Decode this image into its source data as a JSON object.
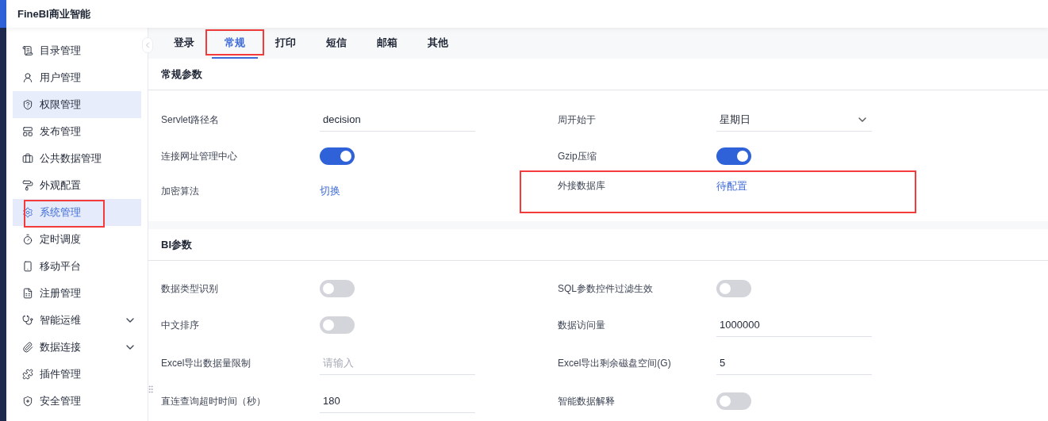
{
  "app": {
    "title": "FineBI商业智能"
  },
  "sidebar": {
    "items": [
      {
        "label": "目录管理",
        "selected": false,
        "hovered": false,
        "annotated": false
      },
      {
        "label": "用户管理",
        "selected": false,
        "hovered": false,
        "annotated": false
      },
      {
        "label": "权限管理",
        "selected": false,
        "hovered": true,
        "annotated": false
      },
      {
        "label": "发布管理",
        "selected": false,
        "hovered": false,
        "annotated": false
      },
      {
        "label": "公共数据管理",
        "selected": false,
        "hovered": false,
        "annotated": false
      },
      {
        "label": "外观配置",
        "selected": false,
        "hovered": false,
        "annotated": false
      },
      {
        "label": "系统管理",
        "selected": true,
        "hovered": false,
        "annotated": true
      },
      {
        "label": "定时调度",
        "selected": false,
        "hovered": false,
        "annotated": false
      },
      {
        "label": "移动平台",
        "selected": false,
        "hovered": false,
        "annotated": false
      },
      {
        "label": "注册管理",
        "selected": false,
        "hovered": false,
        "annotated": false
      },
      {
        "label": "智能运维",
        "selected": false,
        "hovered": false,
        "annotated": false,
        "expanded": false
      },
      {
        "label": "数据连接",
        "selected": false,
        "hovered": false,
        "annotated": false,
        "expanded": false
      },
      {
        "label": "插件管理",
        "selected": false,
        "hovered": false,
        "annotated": false
      },
      {
        "label": "安全管理",
        "selected": false,
        "hovered": false,
        "annotated": false
      }
    ]
  },
  "tabs": [
    {
      "label": "登录",
      "selected": false,
      "annotated": false
    },
    {
      "label": "常规",
      "selected": true,
      "annotated": true
    },
    {
      "label": "打印",
      "selected": false,
      "annotated": false
    },
    {
      "label": "短信",
      "selected": false,
      "annotated": false
    },
    {
      "label": "邮箱",
      "selected": false,
      "annotated": false
    },
    {
      "label": "其他",
      "selected": false,
      "annotated": false
    }
  ],
  "sections": [
    {
      "title": "常规参数",
      "rows": [
        [
          {
            "label": "Servlet路径名",
            "kind": "input",
            "value": "decision",
            "annotated": false
          },
          {
            "label": "周开始于",
            "kind": "select",
            "value": "星期日",
            "annotated": false
          }
        ],
        [
          {
            "label": "连接网址管理中心",
            "kind": "switch",
            "on": true,
            "annotated": false
          },
          {
            "label": "Gzip压缩",
            "kind": "switch",
            "on": true,
            "annotated": false
          }
        ],
        [
          {
            "label": "加密算法",
            "kind": "link",
            "value": "切换",
            "annotated": false
          },
          {
            "label": "外接数据库",
            "kind": "link",
            "value": "待配置",
            "annotated": true
          }
        ]
      ]
    },
    {
      "title": "BI参数",
      "rows": [
        [
          {
            "label": "数据类型识别",
            "kind": "switch",
            "on": false,
            "annotated": false
          },
          {
            "label": "SQL参数控件过滤生效",
            "kind": "switch",
            "on": false,
            "annotated": false
          }
        ],
        [
          {
            "label": "中文排序",
            "kind": "switch",
            "on": false,
            "annotated": false
          },
          {
            "label": "数据访问量",
            "kind": "input",
            "value": "1000000",
            "annotated": false
          }
        ],
        [
          {
            "label": "Excel导出数据量限制",
            "kind": "input",
            "placeholder": "请输入",
            "annotated": false
          },
          {
            "label": "Excel导出剩余磁盘空间(G)",
            "kind": "input",
            "value": "5",
            "annotated": false
          }
        ],
        [
          {
            "label": "直连查询超时时间（秒）",
            "kind": "input",
            "value": "180",
            "annotated": false
          },
          {
            "label": "智能数据解释",
            "kind": "switch",
            "on": false,
            "annotated": false
          }
        ]
      ]
    }
  ]
}
